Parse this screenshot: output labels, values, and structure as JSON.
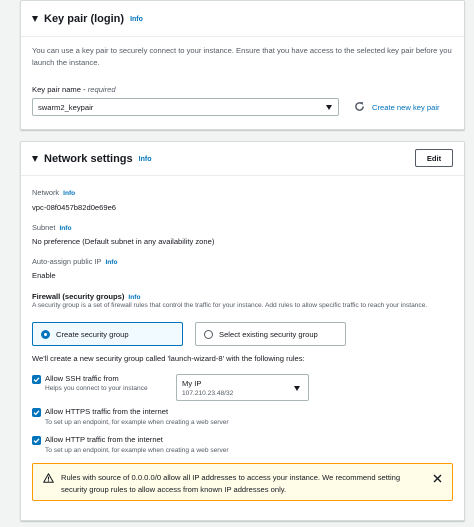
{
  "key_pair": {
    "title": "Key pair (login)",
    "info": "Info",
    "description": "You can use a key pair to securely connect to your instance. Ensure that you have access to the selected key pair before you launch the instance.",
    "field_label": "Key pair name - ",
    "field_required": "required",
    "selected_value": "swarm2_keypair",
    "create_link": "Create new key pair"
  },
  "network": {
    "title": "Network settings",
    "info": "Info",
    "edit_label": "Edit",
    "network_label": "Network",
    "network_info": "Info",
    "network_value": "vpc-08f0457b82d0e69e6",
    "subnet_label": "Subnet",
    "subnet_info": "Info",
    "subnet_value": "No preference (Default subnet in any availability zone)",
    "auto_ip_label": "Auto-assign public IP",
    "auto_ip_info": "Info",
    "auto_ip_value": "Enable",
    "firewall_label": "Firewall (security groups)",
    "firewall_info": "Info",
    "firewall_description": "A security group is a set of firewall rules that control the traffic for your instance. Add rules to allow specific traffic to reach your instance.",
    "radio_create": "Create security group",
    "radio_existing": "Select existing security group",
    "rules_intro": "We'll create a new security group called 'launch-wizard-8' with the following rules:",
    "ssh_label": "Allow SSH traffic from",
    "ssh_desc": "Helps you connect to your instance",
    "ssh_source": "My IP",
    "ssh_source_ip": "107.210.23.48/32",
    "https_label": "Allow HTTPS traffic from the internet",
    "https_desc": "To set up an endpoint, for example when creating a web server",
    "http_label": "Allow HTTP traffic from the internet",
    "http_desc": "To set up an endpoint, for example when creating a web server",
    "warning": "Rules with source of 0.0.0.0/0 allow all IP addresses to access your instance. We recommend setting security group rules to allow access from known IP addresses only."
  },
  "colors": {
    "accent": "#0073bb",
    "warning_border": "#ff9900",
    "warning_bg": "#fffce8"
  }
}
